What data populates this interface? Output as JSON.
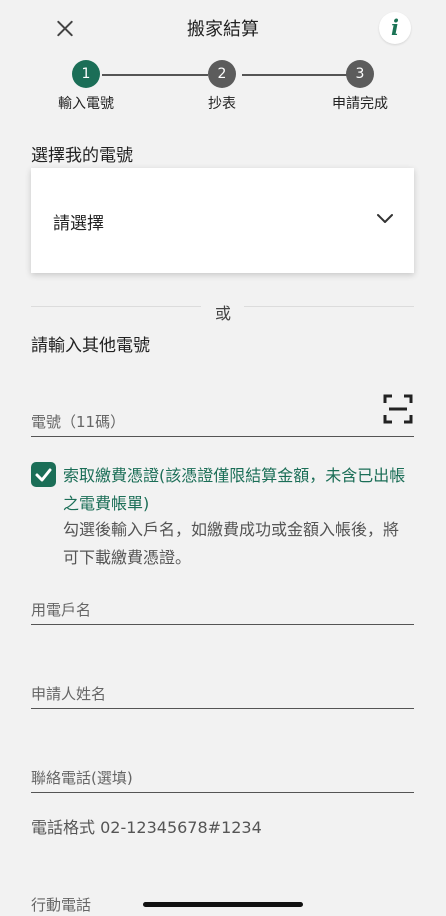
{
  "header": {
    "title": "搬家結算",
    "info_icon": "i"
  },
  "stepper": {
    "steps": [
      {
        "number": "1",
        "label": "輸入電號",
        "state": "active"
      },
      {
        "number": "2",
        "label": "抄表",
        "state": "inactive"
      },
      {
        "number": "3",
        "label": "申請完成",
        "state": "inactive"
      }
    ]
  },
  "select_section": {
    "label": "選擇我的電號",
    "placeholder": "請選擇"
  },
  "divider": {
    "or_text": "或"
  },
  "other_section": {
    "label": "請輸入其他電號",
    "electric_number_placeholder": "電號（11碼）"
  },
  "receipt_option": {
    "checked": true,
    "title": "索取繳費憑證(該憑證僅限結算金額，未含已出帳之電費帳單)",
    "description": "勾選後輸入戶名，如繳費成功或金額入帳後，將可下載繳費憑證。"
  },
  "fields": {
    "account_name_placeholder": "用電戶名",
    "applicant_name_placeholder": "申請人姓名",
    "contact_phone_placeholder": "聯絡電話(選填)",
    "phone_format_hint": "電話格式 02-12345678#1234",
    "mobile_phone_placeholder": "行動電話"
  },
  "colors": {
    "accent": "#1b6e57",
    "background": "#f2f2f2",
    "inactive_step": "#5c5c5c"
  }
}
